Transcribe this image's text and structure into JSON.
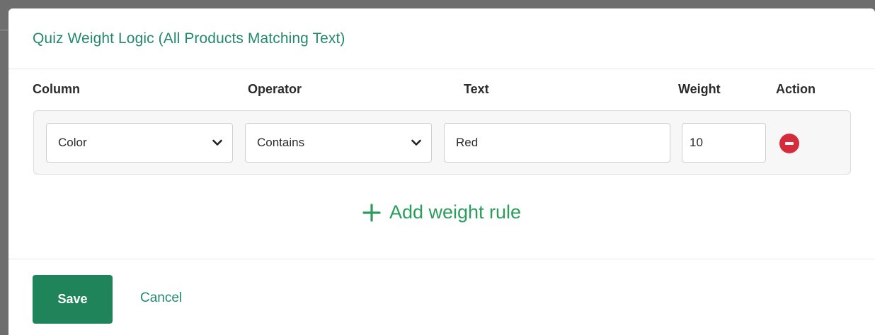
{
  "modal": {
    "title": "Quiz Weight Logic (All Products Matching Text)"
  },
  "columns": {
    "column": "Column",
    "operator": "Operator",
    "text": "Text",
    "weight": "Weight",
    "action": "Action"
  },
  "rules": [
    {
      "column_value": "Color",
      "operator_value": "Contains",
      "text_value": "Red",
      "weight_value": "10"
    }
  ],
  "actions": {
    "add_rule_label": "Add weight rule",
    "save_label": "Save",
    "cancel_label": "Cancel"
  },
  "colors": {
    "accent": "#23896a",
    "save_bg": "#1f845a",
    "add_rule": "#2a9d5c",
    "remove": "#d62b3a"
  },
  "icons": {
    "select_arrow": "chevron-down-icon",
    "remove": "minus-circle-icon",
    "add": "plus-icon"
  }
}
